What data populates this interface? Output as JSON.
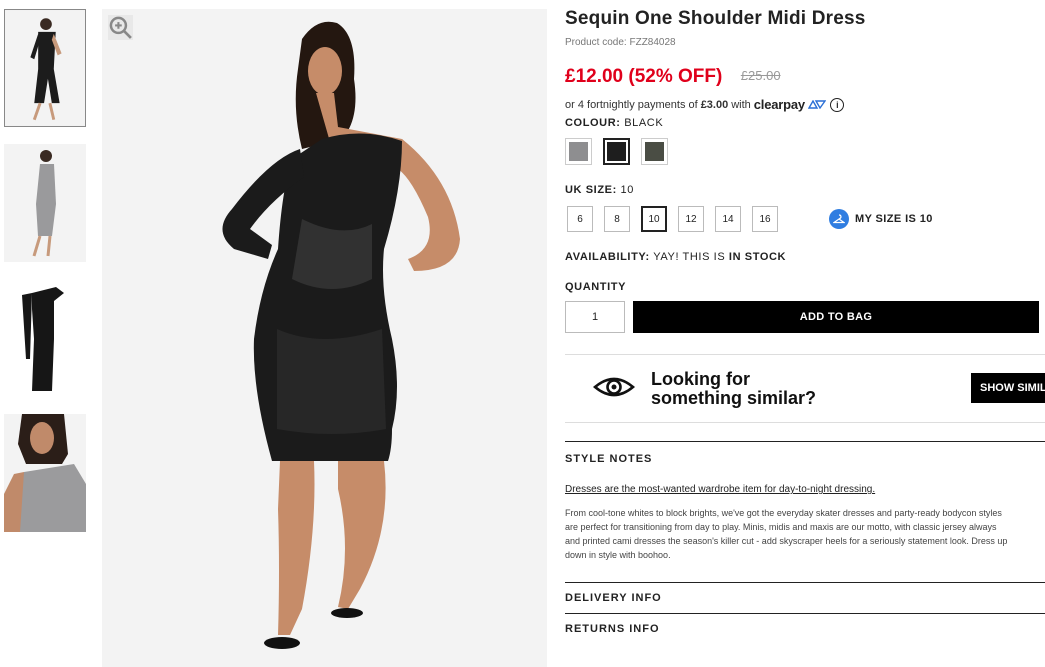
{
  "product": {
    "title": "Sequin One Shoulder Midi Dress",
    "code": "Product code: FZZ84028",
    "price_now": "£12.00 (52% OFF)",
    "price_was": "£25.00"
  },
  "clearpay": {
    "prefix": "or 4 fortnightly payments of",
    "amount": "£3.00",
    "with": "with",
    "logo_text": "clearpay",
    "info_icon": "i"
  },
  "colour": {
    "label": "COLOUR:",
    "value": "BLACK",
    "swatches": [
      {
        "name": "silver",
        "color": "#8e8e90"
      },
      {
        "name": "black",
        "color": "#1e1e1e"
      },
      {
        "name": "khaki",
        "color": "#4a4d44"
      }
    ],
    "selected_index": 1
  },
  "size": {
    "label": "UK SIZE:",
    "value": "10",
    "options": [
      "6",
      "8",
      "10",
      "12",
      "14",
      "16"
    ],
    "selected": "10",
    "my_size_label": "MY SIZE IS 10"
  },
  "availability": {
    "label": "AVAILABILITY:",
    "text": "YAY! THIS IS",
    "status": "IN STOCK"
  },
  "quantity": {
    "label": "QUANTITY",
    "value": "1"
  },
  "actions": {
    "add_to_bag": "ADD TO BAG",
    "show_similar": "SHOW SIMILAR"
  },
  "similar": {
    "line1": "Looking for",
    "line2": "something similar?"
  },
  "style_notes": {
    "heading": "STYLE NOTES",
    "lead": "Dresses are the most-wanted wardrobe item for day-to-night dressing.",
    "body_lines": [
      "From cool-tone whites to block brights, we've got the everyday skater dresses and party-ready bodycon styles",
      "are perfect for transitioning from day to play. Minis, midis and maxis are our motto, with classic jersey always",
      "and printed cami dresses the season's killer cut - add skyscraper heels for a seriously statement look. Dress up",
      "down in style with boohoo."
    ]
  },
  "accordions": {
    "delivery": "DELIVERY INFO",
    "returns": "RETURNS INFO"
  },
  "colors": {
    "price_red": "#e0001b",
    "button_black": "#000000",
    "mysize_blue": "#2f7de1"
  }
}
